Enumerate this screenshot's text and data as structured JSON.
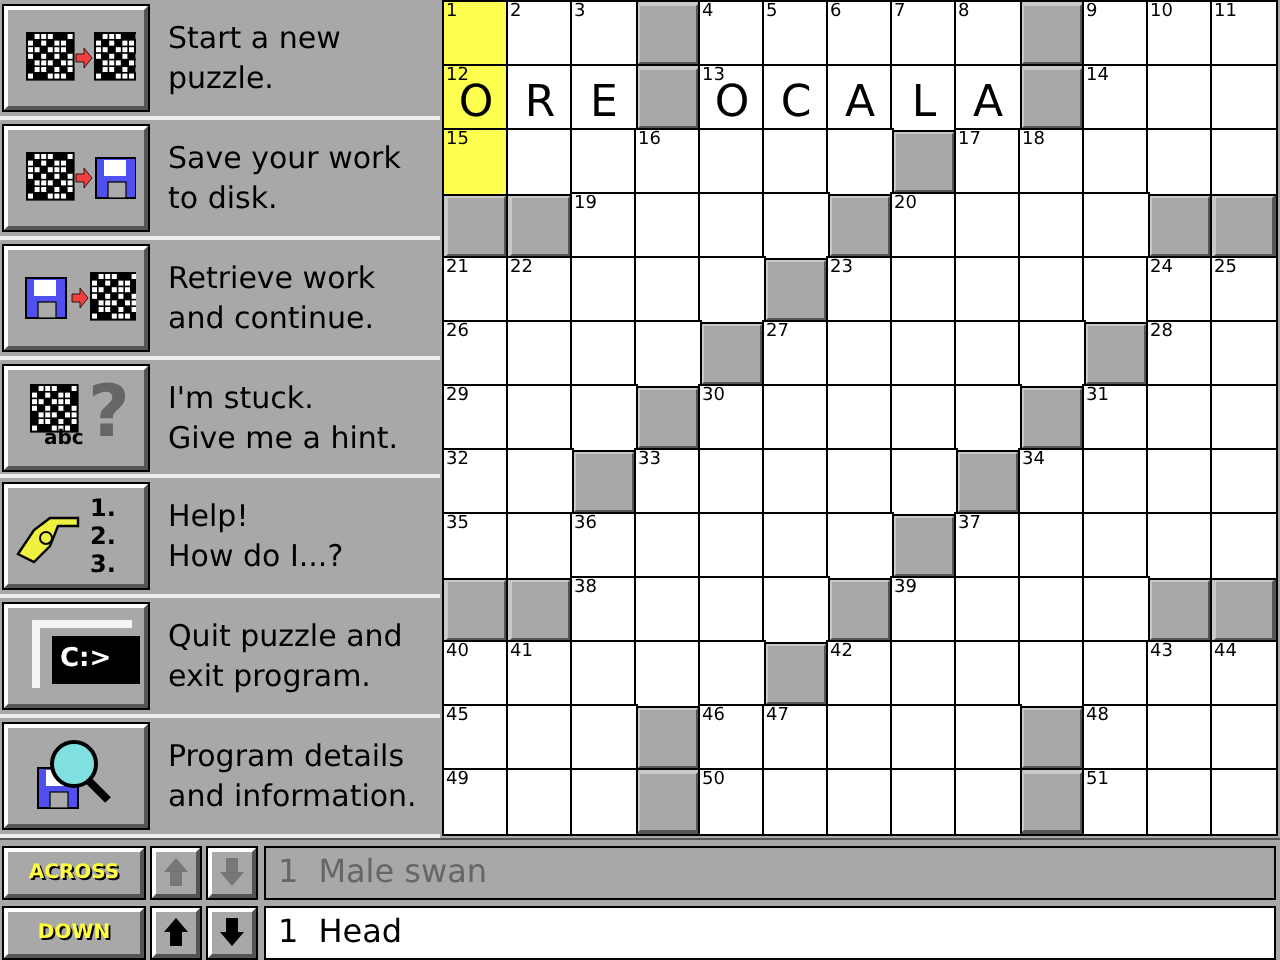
{
  "menu": [
    {
      "kind": "new",
      "lines": [
        "Start a new",
        "puzzle."
      ]
    },
    {
      "kind": "save",
      "lines": [
        "Save your work",
        "to disk."
      ]
    },
    {
      "kind": "retrieve",
      "lines": [
        "Retrieve work",
        "and continue."
      ]
    },
    {
      "kind": "hint",
      "icon_text": "abc",
      "icon_mark": "?",
      "lines": [
        "I'm stuck.",
        "Give me a hint."
      ]
    },
    {
      "kind": "help",
      "icon_lines": [
        "1.",
        "2.",
        "3."
      ],
      "lines": [
        "Help!",
        "How do I...?"
      ]
    },
    {
      "kind": "quit",
      "icon_text": "C:>",
      "lines": [
        "Quit puzzle and",
        "exit program."
      ]
    },
    {
      "kind": "about",
      "lines": [
        "Program details",
        "and information."
      ]
    }
  ],
  "grid": {
    "rows": [
      [
        {
          "kind": "open",
          "number": "1",
          "highlighted": true
        },
        {
          "kind": "open",
          "number": "2",
          "highlighted": false
        },
        {
          "kind": "open",
          "number": "3",
          "highlighted": false
        },
        {
          "kind": "block"
        },
        {
          "kind": "open",
          "number": "4",
          "highlighted": false
        },
        {
          "kind": "open",
          "number": "5",
          "highlighted": false
        },
        {
          "kind": "open",
          "number": "6",
          "highlighted": false
        },
        {
          "kind": "open",
          "number": "7",
          "highlighted": false
        },
        {
          "kind": "open",
          "number": "8",
          "highlighted": false
        },
        {
          "kind": "block"
        },
        {
          "kind": "open",
          "number": "9",
          "highlighted": false
        },
        {
          "kind": "open",
          "number": "10",
          "highlighted": false
        },
        {
          "kind": "open",
          "number": "11",
          "highlighted": false
        }
      ],
      [
        {
          "kind": "open",
          "number": "12",
          "letter": "O",
          "highlighted": true
        },
        {
          "kind": "open",
          "letter": "R",
          "highlighted": false
        },
        {
          "kind": "open",
          "letter": "E",
          "highlighted": false
        },
        {
          "kind": "block"
        },
        {
          "kind": "open",
          "number": "13",
          "letter": "O",
          "highlighted": false
        },
        {
          "kind": "open",
          "letter": "C",
          "highlighted": false
        },
        {
          "kind": "open",
          "letter": "A",
          "highlighted": false
        },
        {
          "kind": "open",
          "letter": "L",
          "highlighted": false
        },
        {
          "kind": "open",
          "letter": "A",
          "highlighted": false
        },
        {
          "kind": "block"
        },
        {
          "kind": "open",
          "number": "14",
          "highlighted": false
        },
        {
          "kind": "open",
          "highlighted": false
        },
        {
          "kind": "open",
          "highlighted": false
        }
      ],
      [
        {
          "kind": "open",
          "number": "15",
          "highlighted": true
        },
        {
          "kind": "open",
          "highlighted": false
        },
        {
          "kind": "open",
          "highlighted": false
        },
        {
          "kind": "open",
          "number": "16",
          "highlighted": false
        },
        {
          "kind": "open",
          "highlighted": false
        },
        {
          "kind": "open",
          "highlighted": false
        },
        {
          "kind": "open",
          "highlighted": false
        },
        {
          "kind": "block"
        },
        {
          "kind": "open",
          "number": "17",
          "highlighted": false
        },
        {
          "kind": "open",
          "number": "18",
          "highlighted": false
        },
        {
          "kind": "open",
          "highlighted": false
        },
        {
          "kind": "open",
          "highlighted": false
        },
        {
          "kind": "open",
          "highlighted": false
        }
      ],
      [
        {
          "kind": "block"
        },
        {
          "kind": "block"
        },
        {
          "kind": "open",
          "number": "19",
          "highlighted": false
        },
        {
          "kind": "open",
          "highlighted": false
        },
        {
          "kind": "open",
          "highlighted": false
        },
        {
          "kind": "open",
          "highlighted": false
        },
        {
          "kind": "block"
        },
        {
          "kind": "open",
          "number": "20",
          "highlighted": false
        },
        {
          "kind": "open",
          "highlighted": false
        },
        {
          "kind": "open",
          "highlighted": false
        },
        {
          "kind": "open",
          "highlighted": false
        },
        {
          "kind": "block"
        },
        {
          "kind": "block"
        }
      ],
      [
        {
          "kind": "open",
          "number": "21",
          "highlighted": false
        },
        {
          "kind": "open",
          "number": "22",
          "highlighted": false
        },
        {
          "kind": "open",
          "highlighted": false
        },
        {
          "kind": "open",
          "highlighted": false
        },
        {
          "kind": "open",
          "highlighted": false
        },
        {
          "kind": "block"
        },
        {
          "kind": "open",
          "number": "23",
          "highlighted": false
        },
        {
          "kind": "open",
          "highlighted": false
        },
        {
          "kind": "open",
          "highlighted": false
        },
        {
          "kind": "open",
          "highlighted": false
        },
        {
          "kind": "open",
          "highlighted": false
        },
        {
          "kind": "open",
          "number": "24",
          "highlighted": false
        },
        {
          "kind": "open",
          "number": "25",
          "highlighted": false
        }
      ],
      [
        {
          "kind": "open",
          "number": "26",
          "highlighted": false
        },
        {
          "kind": "open",
          "highlighted": false
        },
        {
          "kind": "open",
          "highlighted": false
        },
        {
          "kind": "open",
          "highlighted": false
        },
        {
          "kind": "block"
        },
        {
          "kind": "open",
          "number": "27",
          "highlighted": false
        },
        {
          "kind": "open",
          "highlighted": false
        },
        {
          "kind": "open",
          "highlighted": false
        },
        {
          "kind": "open",
          "highlighted": false
        },
        {
          "kind": "open",
          "highlighted": false
        },
        {
          "kind": "block"
        },
        {
          "kind": "open",
          "number": "28",
          "highlighted": false
        },
        {
          "kind": "open",
          "highlighted": false
        }
      ],
      [
        {
          "kind": "open",
          "number": "29",
          "highlighted": false
        },
        {
          "kind": "open",
          "highlighted": false
        },
        {
          "kind": "open",
          "highlighted": false
        },
        {
          "kind": "block"
        },
        {
          "kind": "open",
          "number": "30",
          "highlighted": false
        },
        {
          "kind": "open",
          "highlighted": false
        },
        {
          "kind": "open",
          "highlighted": false
        },
        {
          "kind": "open",
          "highlighted": false
        },
        {
          "kind": "open",
          "highlighted": false
        },
        {
          "kind": "block"
        },
        {
          "kind": "open",
          "number": "31",
          "highlighted": false
        },
        {
          "kind": "open",
          "highlighted": false
        },
        {
          "kind": "open",
          "highlighted": false
        }
      ],
      [
        {
          "kind": "open",
          "number": "32",
          "highlighted": false
        },
        {
          "kind": "open",
          "highlighted": false
        },
        {
          "kind": "block"
        },
        {
          "kind": "open",
          "number": "33",
          "highlighted": false
        },
        {
          "kind": "open",
          "highlighted": false
        },
        {
          "kind": "open",
          "highlighted": false
        },
        {
          "kind": "open",
          "highlighted": false
        },
        {
          "kind": "open",
          "highlighted": false
        },
        {
          "kind": "block"
        },
        {
          "kind": "open",
          "number": "34",
          "highlighted": false
        },
        {
          "kind": "open",
          "highlighted": false
        },
        {
          "kind": "open",
          "highlighted": false
        },
        {
          "kind": "open",
          "highlighted": false
        }
      ],
      [
        {
          "kind": "open",
          "number": "35",
          "highlighted": false
        },
        {
          "kind": "open",
          "highlighted": false
        },
        {
          "kind": "open",
          "number": "36",
          "highlighted": false
        },
        {
          "kind": "open",
          "highlighted": false
        },
        {
          "kind": "open",
          "highlighted": false
        },
        {
          "kind": "open",
          "highlighted": false
        },
        {
          "kind": "open",
          "highlighted": false
        },
        {
          "kind": "block"
        },
        {
          "kind": "open",
          "number": "37",
          "highlighted": false
        },
        {
          "kind": "open",
          "highlighted": false
        },
        {
          "kind": "open",
          "highlighted": false
        },
        {
          "kind": "open",
          "highlighted": false
        },
        {
          "kind": "open",
          "highlighted": false
        }
      ],
      [
        {
          "kind": "block"
        },
        {
          "kind": "block"
        },
        {
          "kind": "open",
          "number": "38",
          "highlighted": false
        },
        {
          "kind": "open",
          "highlighted": false
        },
        {
          "kind": "open",
          "highlighted": false
        },
        {
          "kind": "open",
          "highlighted": false
        },
        {
          "kind": "block"
        },
        {
          "kind": "open",
          "number": "39",
          "highlighted": false
        },
        {
          "kind": "open",
          "highlighted": false
        },
        {
          "kind": "open",
          "highlighted": false
        },
        {
          "kind": "open",
          "highlighted": false
        },
        {
          "kind": "block"
        },
        {
          "kind": "block"
        }
      ],
      [
        {
          "kind": "open",
          "number": "40",
          "highlighted": false
        },
        {
          "kind": "open",
          "number": "41",
          "highlighted": false
        },
        {
          "kind": "open",
          "highlighted": false
        },
        {
          "kind": "open",
          "highlighted": false
        },
        {
          "kind": "open",
          "highlighted": false
        },
        {
          "kind": "block"
        },
        {
          "kind": "open",
          "number": "42",
          "highlighted": false
        },
        {
          "kind": "open",
          "highlighted": false
        },
        {
          "kind": "open",
          "highlighted": false
        },
        {
          "kind": "open",
          "highlighted": false
        },
        {
          "kind": "open",
          "highlighted": false
        },
        {
          "kind": "open",
          "number": "43",
          "highlighted": false
        },
        {
          "kind": "open",
          "number": "44",
          "highlighted": false
        }
      ],
      [
        {
          "kind": "open",
          "number": "45",
          "highlighted": false
        },
        {
          "kind": "open",
          "highlighted": false
        },
        {
          "kind": "open",
          "highlighted": false
        },
        {
          "kind": "block"
        },
        {
          "kind": "open",
          "number": "46",
          "highlighted": false
        },
        {
          "kind": "open",
          "number": "47",
          "highlighted": false
        },
        {
          "kind": "open",
          "highlighted": false
        },
        {
          "kind": "open",
          "highlighted": false
        },
        {
          "kind": "open",
          "highlighted": false
        },
        {
          "kind": "block"
        },
        {
          "kind": "open",
          "number": "48",
          "highlighted": false
        },
        {
          "kind": "open",
          "highlighted": false
        },
        {
          "kind": "open",
          "highlighted": false
        }
      ],
      [
        {
          "kind": "open",
          "number": "49",
          "highlighted": false
        },
        {
          "kind": "open",
          "highlighted": false
        },
        {
          "kind": "open",
          "highlighted": false
        },
        {
          "kind": "block"
        },
        {
          "kind": "open",
          "number": "50",
          "highlighted": false
        },
        {
          "kind": "open",
          "highlighted": false
        },
        {
          "kind": "open",
          "highlighted": false
        },
        {
          "kind": "open",
          "highlighted": false
        },
        {
          "kind": "open",
          "highlighted": false
        },
        {
          "kind": "block"
        },
        {
          "kind": "open",
          "number": "51",
          "highlighted": false
        },
        {
          "kind": "open",
          "highlighted": false
        },
        {
          "kind": "open",
          "highlighted": false
        }
      ]
    ]
  },
  "clues": [
    {
      "direction": "ACROSS",
      "active": false,
      "number": "1",
      "text": "Male swan"
    },
    {
      "direction": "DOWN",
      "active": true,
      "number": "1",
      "text": "Head"
    }
  ]
}
